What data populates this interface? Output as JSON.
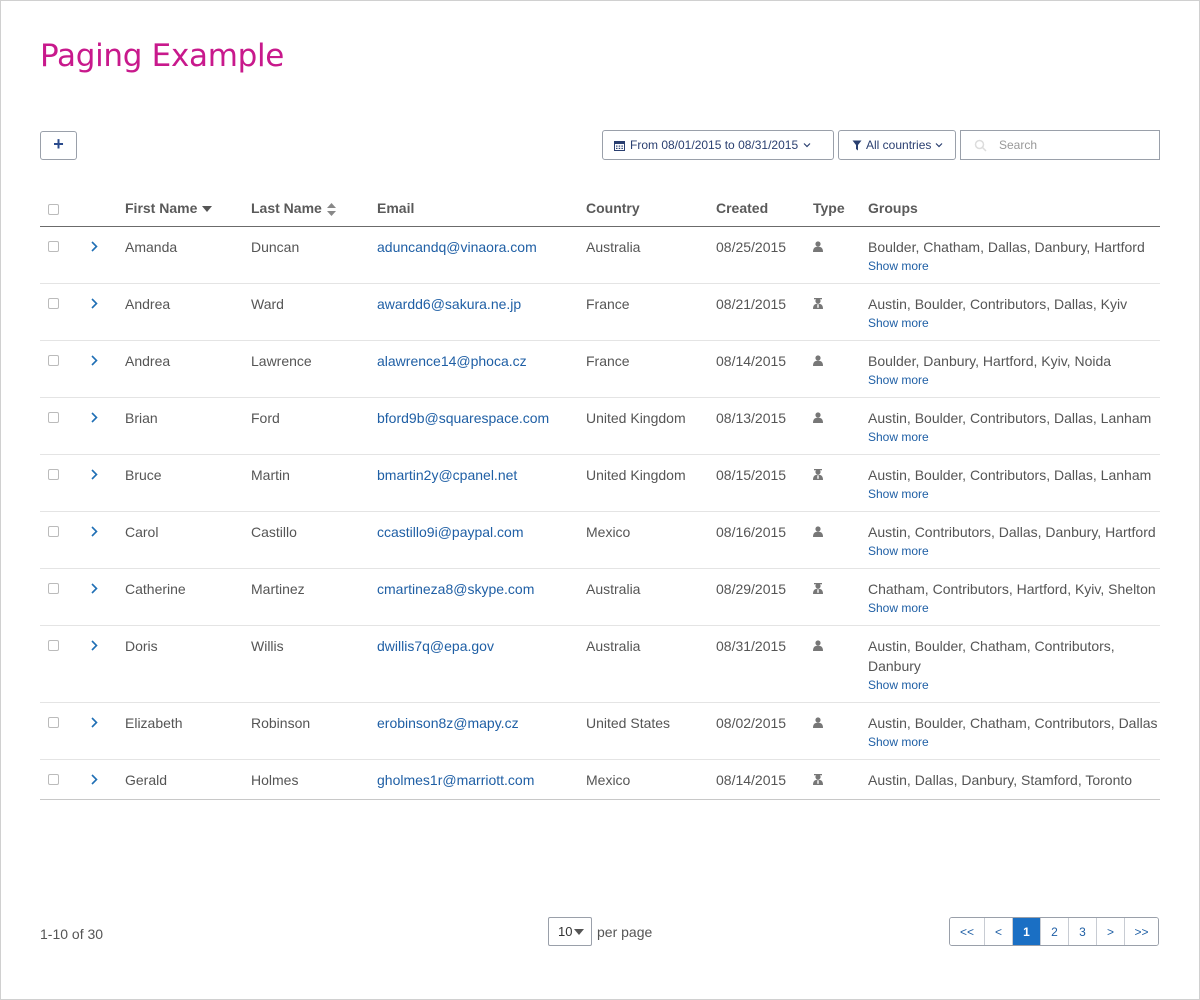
{
  "header": {
    "title": "Paging Example"
  },
  "toolbar": {
    "add_label": "+",
    "date_range_label": "From 08/01/2015 to 08/31/2015",
    "country_filter_label": "All countries",
    "search_placeholder": "Search"
  },
  "table": {
    "columns": [
      "First Name",
      "Last Name",
      "Email",
      "Country",
      "Created",
      "Type",
      "Groups"
    ],
    "show_more_label": "Show more",
    "rows": [
      {
        "first": "Amanda",
        "last": "Duncan",
        "email": "aduncandq@vinaora.com",
        "country": "Australia",
        "created": "08/25/2015",
        "type": "user-icon",
        "groups": "Boulder, Chatham, Dallas, Danbury, Hartford"
      },
      {
        "first": "Andrea",
        "last": "Ward",
        "email": "awardd6@sakura.ne.jp",
        "country": "France",
        "created": "08/21/2015",
        "type": "admin-icon",
        "groups": "Austin, Boulder, Contributors, Dallas, Kyiv"
      },
      {
        "first": "Andrea",
        "last": "Lawrence",
        "email": "alawrence14@phoca.cz",
        "country": "France",
        "created": "08/14/2015",
        "type": "user-icon",
        "groups": "Boulder, Danbury, Hartford, Kyiv, Noida"
      },
      {
        "first": "Brian",
        "last": "Ford",
        "email": "bford9b@squarespace.com",
        "country": "United Kingdom",
        "created": "08/13/2015",
        "type": "user-icon",
        "groups": "Austin, Boulder, Contributors, Dallas, Lanham"
      },
      {
        "first": "Bruce",
        "last": "Martin",
        "email": "bmartin2y@cpanel.net",
        "country": "United Kingdom",
        "created": "08/15/2015",
        "type": "admin-icon",
        "groups": "Austin, Boulder, Contributors, Dallas, Lanham"
      },
      {
        "first": "Carol",
        "last": "Castillo",
        "email": "ccastillo9i@paypal.com",
        "country": "Mexico",
        "created": "08/16/2015",
        "type": "user-icon",
        "groups": "Austin, Contributors, Dallas, Danbury, Hartford"
      },
      {
        "first": "Catherine",
        "last": "Martinez",
        "email": "cmartineza8@skype.com",
        "country": "Australia",
        "created": "08/29/2015",
        "type": "admin-icon",
        "groups": "Chatham, Contributors, Hartford, Kyiv, Shelton"
      },
      {
        "first": "Doris",
        "last": "Willis",
        "email": "dwillis7q@epa.gov",
        "country": "Australia",
        "created": "08/31/2015",
        "type": "user-icon",
        "groups": "Austin, Boulder, Chatham, Contributors, Danbury"
      },
      {
        "first": "Elizabeth",
        "last": "Robinson",
        "email": "erobinson8z@mapy.cz",
        "country": "United States",
        "created": "08/02/2015",
        "type": "user-icon",
        "groups": "Austin, Boulder, Chatham, Contributors, Dallas"
      },
      {
        "first": "Gerald",
        "last": "Holmes",
        "email": "gholmes1r@marriott.com",
        "country": "Mexico",
        "created": "08/14/2015",
        "type": "admin-icon",
        "groups": "Austin, Dallas, Danbury, Stamford, Toronto"
      }
    ]
  },
  "footer": {
    "count_label": "1-10 of 30",
    "per_page_value": "10",
    "per_page_label": "per page",
    "pages": [
      "<<",
      "<",
      "1",
      "2",
      "3",
      ">",
      ">>"
    ],
    "active_page": "1"
  },
  "colors": {
    "title": "#c8198c",
    "link": "#1f5fa5",
    "active_page": "#1a6fc4"
  }
}
